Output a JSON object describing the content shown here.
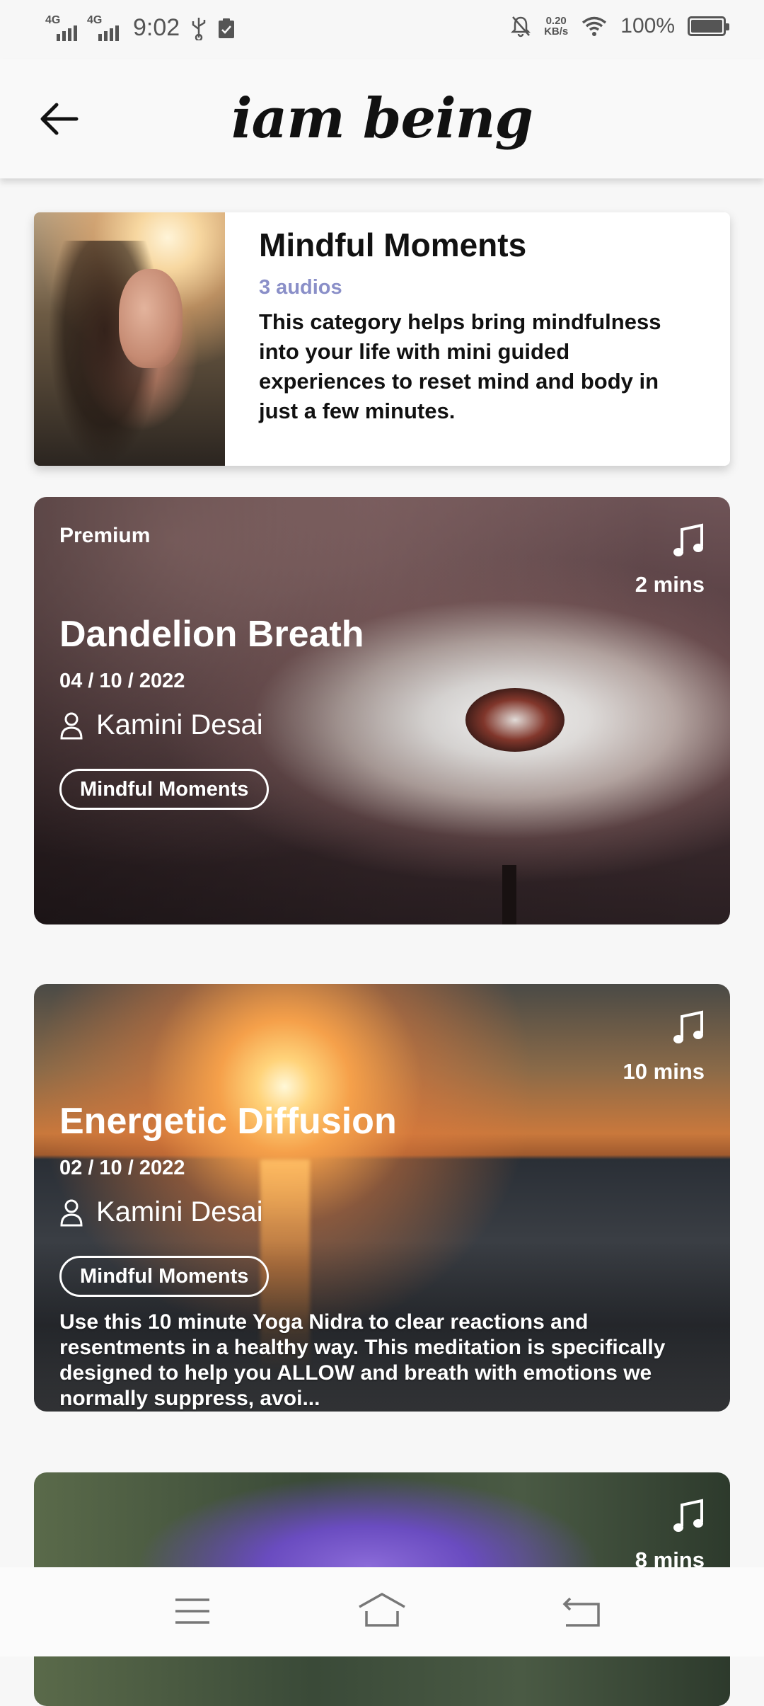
{
  "status_bar": {
    "signal1": "4G",
    "signal2": "4G",
    "time": "9:02",
    "net_speed_value": "0.20",
    "net_speed_unit": "KB/s",
    "battery_percent": "100%",
    "battery_level": 1.0
  },
  "header": {
    "logo_text": "iam being"
  },
  "category": {
    "title": "Mindful Moments",
    "count_label": "3 audios",
    "description": "This category helps bring mindfulness into your life with mini guided experiences to reset mind and body in just a few minutes."
  },
  "audios": [
    {
      "badge": "Premium",
      "duration": "2 mins",
      "title": "Dandelion Breath",
      "date": "04 / 10 / 2022",
      "author": "Kamini Desai",
      "tag": "Mindful Moments",
      "description": ""
    },
    {
      "badge": "",
      "duration": "10 mins",
      "title": "Energetic Diffusion",
      "date": "02 / 10 / 2022",
      "author": "Kamini Desai",
      "tag": "Mindful Moments",
      "description": "Use this 10 minute Yoga Nidra to clear reactions and resentments in a healthy way. This meditation is specifically designed to help you ALLOW and breath with emotions we normally suppress, avoi..."
    },
    {
      "badge": "",
      "duration": "8 mins"
    }
  ],
  "colors": {
    "accent": "#8a8fc8",
    "background": "#f7f7f7"
  },
  "icons": {
    "back": "arrow-left-icon",
    "music": "music-note-icon",
    "author": "person-icon",
    "nav_menu": "menu-icon",
    "nav_home": "home-icon",
    "nav_back": "back-icon"
  }
}
